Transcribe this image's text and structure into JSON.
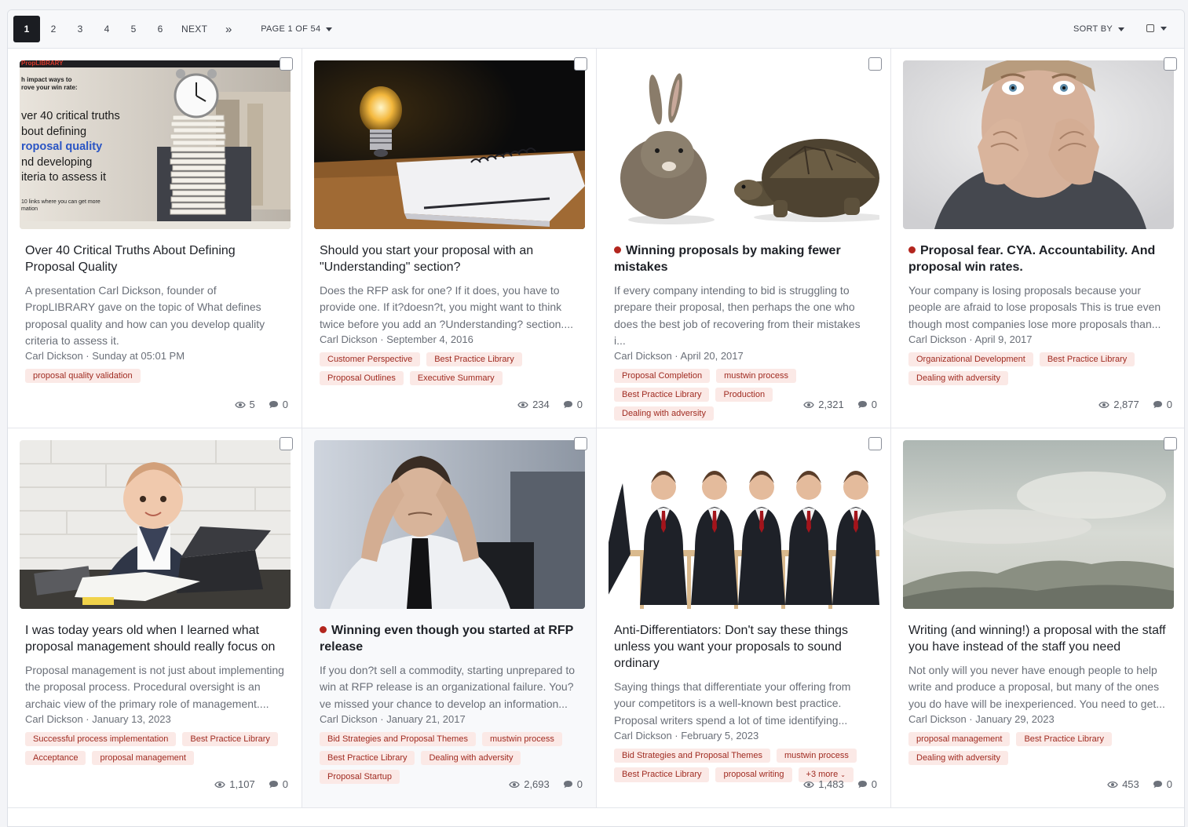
{
  "pagination": {
    "pages": [
      "1",
      "2",
      "3",
      "4",
      "5",
      "6"
    ],
    "active": "1",
    "next_label": "NEXT",
    "last_label": "»",
    "page_select": "PAGE 1 OF 54"
  },
  "sort": {
    "label": "SORT BY"
  },
  "cards": [
    {
      "title": "Over 40 Critical Truths About Defining Proposal Quality",
      "bold": false,
      "excerpt": "A presentation Carl Dickson, founder of PropLIBRARY gave on the topic of What defines proposal quality and how can you develop quality criteria to assess it.",
      "meta": "Carl Dickson · Sunday at 05:01 PM",
      "tags": [
        "proposal quality validation"
      ],
      "views": "5",
      "comments": "0",
      "thumb": {
        "brand": "PropLIBRARY",
        "small_text": "h impact ways to\nrove your win rate:",
        "lines": [
          "ver 40 critical truths",
          "bout defining",
          "roposal quality",
          "nd developing",
          "iteria to assess it"
        ],
        "footer": "10 links where you can get more\nmation"
      }
    },
    {
      "title": "Should you start your proposal with an \"Understanding\" section?",
      "bold": false,
      "excerpt": "Does the RFP ask for one? If it does, you have to provide one. If it?doesn?t, you might want to think twice before you add an ?Understanding? section....",
      "meta": "Carl Dickson · September 4, 2016",
      "tags": [
        "Customer Perspective",
        "Best Practice Library",
        "Proposal Outlines",
        "Executive Summary"
      ],
      "views": "234",
      "comments": "0"
    },
    {
      "title": "Winning proposals by making fewer mistakes",
      "bold": true,
      "excerpt": "If every company intending to bid is struggling to prepare their proposal, then perhaps the one who does the best job of recovering from their mistakes i...",
      "meta": "Carl Dickson · April 20, 2017",
      "tags": [
        "Proposal Completion",
        "mustwin process",
        "Best Practice Library",
        "Production",
        "Dealing with adversity"
      ],
      "views": "2,321",
      "comments": "0"
    },
    {
      "title": "Proposal fear. CYA. Accountability. And proposal win rates.",
      "bold": true,
      "excerpt": "Your company is losing proposals because your people are afraid to lose proposals This is true even though most companies lose more proposals than...",
      "meta": "Carl Dickson · April 9, 2017",
      "tags": [
        "Organizational Development",
        "Best Practice Library",
        "Dealing with adversity"
      ],
      "views": "2,877",
      "comments": "0"
    },
    {
      "title": "I was today years old when I learned what proposal management should really focus on",
      "bold": false,
      "excerpt": "Proposal management is not just about implementing the proposal process. Procedural oversight is an archaic view of the primary role of management....",
      "meta": "Carl Dickson · January 13, 2023",
      "tags": [
        "Successful process implementation",
        "Best Practice Library",
        "Acceptance",
        "proposal management"
      ],
      "views": "1,107",
      "comments": "0"
    },
    {
      "title": "Winning even though you started at RFP release",
      "bold": true,
      "excerpt": "If you don?t sell a commodity, starting unprepared to win at RFP release is an organizational failure. You?ve missed your chance to develop an information...",
      "meta": "Carl Dickson · January 21, 2017",
      "tags": [
        "Bid Strategies and Proposal Themes",
        "mustwin process",
        "Best Practice Library",
        "Dealing with adversity",
        "Proposal Startup"
      ],
      "views": "2,693",
      "comments": "0"
    },
    {
      "title": "Anti-Differentiators: Don't say these things unless you want your proposals to sound ordinary",
      "bold": false,
      "excerpt": "Saying things that differentiate your offering from your competitors is a well-known best practice. Proposal writers spend a lot of time identifying...",
      "meta": "Carl Dickson · February 5, 2023",
      "tags": [
        "Bid Strategies and Proposal Themes",
        "mustwin process",
        "Best Practice Library",
        "proposal writing"
      ],
      "more_tag": "+3 more",
      "views": "1,483",
      "comments": "0"
    },
    {
      "title": "Writing (and winning!) a proposal with the staff you have instead of the staff you need",
      "bold": false,
      "excerpt": "Not only will you never have enough people to help write and produce a proposal, but many of the ones you do have will be inexperienced. You need to get...",
      "meta": "Carl Dickson · January 29, 2023",
      "tags": [
        "proposal management",
        "Best Practice Library",
        "Dealing with adversity"
      ],
      "views": "453",
      "comments": "0"
    }
  ]
}
